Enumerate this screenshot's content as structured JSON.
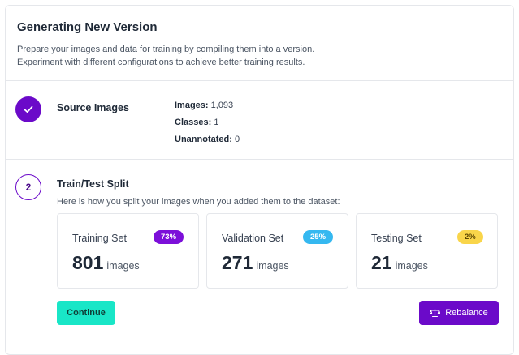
{
  "header": {
    "title": "Generating New Version",
    "description_line1": "Prepare your images and data for training by compiling them into a version.",
    "description_line2": "Experiment with different configurations to achieve better training results."
  },
  "source_images": {
    "title": "Source Images",
    "status_icon": "check-icon",
    "stats": [
      {
        "label": "Images:",
        "value": "1,093"
      },
      {
        "label": "Classes:",
        "value": "1"
      },
      {
        "label": "Unannotated:",
        "value": "0"
      }
    ]
  },
  "train_test_split": {
    "step_number": "2",
    "title": "Train/Test Split",
    "description": "Here is how you split your images when you added them to the dataset:",
    "sets": [
      {
        "name": "Training Set",
        "percent": "73%",
        "count": "801",
        "unit": "images",
        "badge_bg": "#7c0fd9",
        "badge_fg": "#ffffff"
      },
      {
        "name": "Validation Set",
        "percent": "25%",
        "count": "271",
        "unit": "images",
        "badge_bg": "#35b8f0",
        "badge_fg": "#ffffff"
      },
      {
        "name": "Testing Set",
        "percent": "2%",
        "count": "21",
        "unit": "images",
        "badge_bg": "#f9d54a",
        "badge_fg": "#5a4500"
      }
    ]
  },
  "actions": {
    "continue_label": "Continue",
    "rebalance_label": "Rebalance",
    "rebalance_icon": "scale-balance-icon"
  },
  "colors": {
    "accent_purple": "#6b0ac9",
    "continue_teal": "#19e6c7"
  }
}
